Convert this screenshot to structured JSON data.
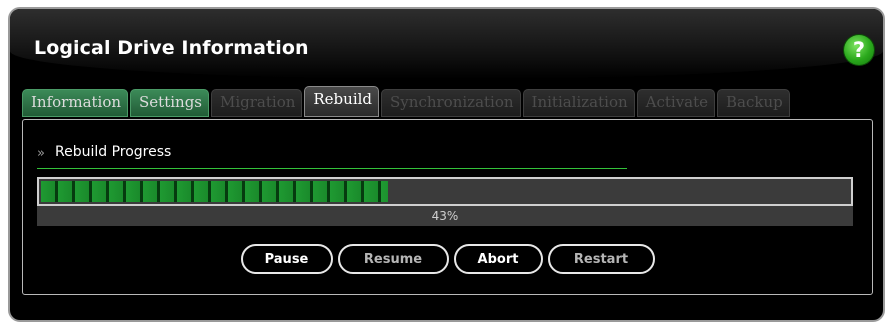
{
  "header": {
    "title": "Logical Drive Information",
    "help_icon": "?"
  },
  "tabs": [
    {
      "label": "Information",
      "state": "enabled"
    },
    {
      "label": "Settings",
      "state": "enabled"
    },
    {
      "label": "Migration",
      "state": "disabled"
    },
    {
      "label": "Rebuild",
      "state": "active"
    },
    {
      "label": "Synchronization",
      "state": "disabled"
    },
    {
      "label": "Initialization",
      "state": "disabled"
    },
    {
      "label": "Activate",
      "state": "disabled"
    },
    {
      "label": "Backup",
      "state": "disabled"
    }
  ],
  "section": {
    "icon": "double-chevron-down-icon",
    "title": "Rebuild Progress"
  },
  "progress": {
    "percent": 43,
    "label": "43%",
    "bar_color": "#1f9a32"
  },
  "buttons": {
    "pause": "Pause",
    "resume": "Resume",
    "abort": "Abort",
    "restart": "Restart"
  },
  "colors": {
    "accent_green": "#33c23a",
    "help_green": "#2aa81c"
  }
}
